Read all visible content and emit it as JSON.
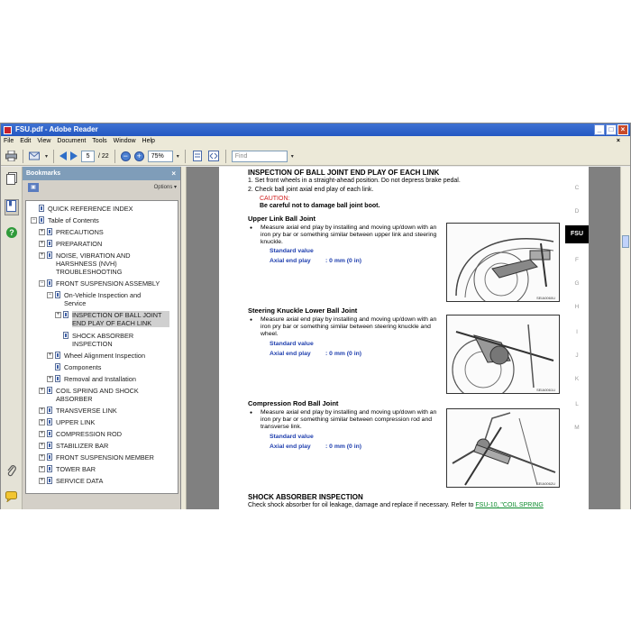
{
  "window": {
    "title": "FSU.pdf - Adobe Reader"
  },
  "menu": [
    "File",
    "Edit",
    "View",
    "Document",
    "Tools",
    "Window",
    "Help"
  ],
  "menu_close": "×",
  "toolbar": {
    "page_current": "5",
    "page_total": "/ 22",
    "zoom": "75%",
    "find_placeholder": "Find"
  },
  "bookmarks": {
    "title": "Bookmarks",
    "close": "×",
    "options": "Options ▾",
    "items": [
      {
        "label": "QUICK REFERENCE INDEX",
        "expander": ""
      },
      {
        "label": "Table of Contents",
        "expander": "−"
      },
      {
        "label": "PRECAUTIONS",
        "expander": "+"
      },
      {
        "label": "PREPARATION",
        "expander": "+"
      },
      {
        "label": "NOISE, VIBRATION AND HARSHNESS (NVH) TROUBLESHOOTING",
        "expander": "+"
      },
      {
        "label": "FRONT SUSPENSION ASSEMBLY",
        "expander": "−"
      },
      {
        "label": "On-Vehicle Inspection and Service",
        "expander": "−"
      },
      {
        "label": "INSPECTION OF BALL JOINT END PLAY OF EACH LINK",
        "expander": "+"
      },
      {
        "label": "SHOCK ABSORBER INSPECTION",
        "expander": ""
      },
      {
        "label": "Wheel Alignment Inspection",
        "expander": "+"
      },
      {
        "label": "Components",
        "expander": ""
      },
      {
        "label": "Removal and Installation",
        "expander": "+"
      },
      {
        "label": "COIL SPRING AND SHOCK ABSORBER",
        "expander": "+"
      },
      {
        "label": "TRANSVERSE LINK",
        "expander": "+"
      },
      {
        "label": "UPPER LINK",
        "expander": "+"
      },
      {
        "label": "COMPRESSION ROD",
        "expander": "+"
      },
      {
        "label": "STABILIZER BAR",
        "expander": "+"
      },
      {
        "label": "FRONT SUSPENSION MEMBER",
        "expander": "+"
      },
      {
        "label": "TOWER BAR",
        "expander": "+"
      },
      {
        "label": "SERVICE DATA",
        "expander": "+"
      }
    ]
  },
  "document": {
    "heading": "INSPECTION OF BALL JOINT END PLAY OF EACH LINK",
    "step1": "1.   Set front wheels in a straight-ahead position. Do not depress brake pedal.",
    "step2": "2.   Check ball joint axial end play of each link.",
    "caution_label": "CAUTION:",
    "caution_text": "Be careful not to damage ball joint boot.",
    "sections": [
      {
        "title": "Upper Link Ball Joint",
        "bullet": "Measure axial end play by installing and moving up/down with an iron pry bar or something similar between upper link and steering knuckle.",
        "std_label": "Standard value",
        "val_label": "Axial end play",
        "val": ": 0 mm (0 in)",
        "fig_code": "SEIA0060U"
      },
      {
        "title": "Steering Knuckle Lower Ball Joint",
        "bullet": "Measure axial end play by installing and moving up/down with an iron pry bar or something similar between steering knuckle and wheel.",
        "std_label": "Standard value",
        "val_label": "Axial end play",
        "val": ": 0 mm (0 in)",
        "fig_code": "SEIA0061U"
      },
      {
        "title": "Compression Rod Ball Joint",
        "bullet": "Measure axial end play by installing and moving up/down with an iron pry bar or something similar between compression rod and transverse link.",
        "std_label": "Standard value",
        "val_label": "Axial end play",
        "val": ": 0 mm (0 in)",
        "fig_code": "SEIA0062U"
      }
    ],
    "shock_heading": "SHOCK ABSORBER INSPECTION",
    "shock_text": "Check shock absorber for oil leakage, damage and replace if necessary. Refer to ",
    "shock_link": "FSU-10, \"COIL SPRING",
    "side_letters": [
      "C",
      "D",
      "FSU",
      "F",
      "G",
      "H",
      "I",
      "J",
      "K",
      "L",
      "M"
    ]
  },
  "icons": {
    "app": "adobe-reader-icon",
    "print": "printer-icon",
    "email": "email-icon",
    "prev": "previous-page-icon",
    "next": "next-page-icon",
    "zoom_out": "zoom-out-icon",
    "zoom_in": "zoom-in-icon",
    "pages": "pages-icon",
    "bookmarks": "bookmarks-icon",
    "help": "help-icon",
    "attach": "paperclip-icon",
    "comments": "comments-icon"
  }
}
